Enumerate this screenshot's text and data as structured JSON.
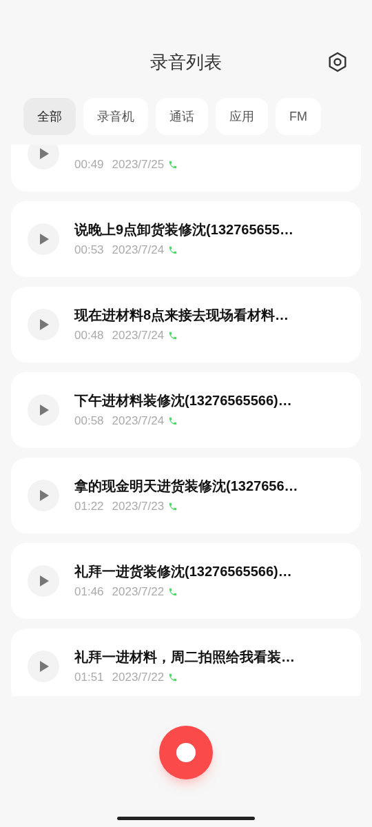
{
  "header": {
    "title": "录音列表"
  },
  "tabs": [
    {
      "label": "全部",
      "selected": true
    },
    {
      "label": "录音机",
      "selected": false
    },
    {
      "label": "通话",
      "selected": false
    },
    {
      "label": "应用",
      "selected": false
    },
    {
      "label": "FM",
      "selected": false
    }
  ],
  "recordings": [
    {
      "duration": "00:49",
      "date": "2023/7/25"
    },
    {
      "title": "说晚上9点卸货装修沈(132765655…",
      "duration": "00:53",
      "date": "2023/7/24"
    },
    {
      "title": "现在进材料8点来接去现场看材料…",
      "duration": "00:48",
      "date": "2023/7/24"
    },
    {
      "title": "下午进材料装修沈(13276565566)…",
      "duration": "00:58",
      "date": "2023/7/24"
    },
    {
      "title": "拿的现金明天进货装修沈(1327656…",
      "duration": "01:22",
      "date": "2023/7/23"
    },
    {
      "title": "礼拜一进货装修沈(13276565566)…",
      "duration": "01:46",
      "date": "2023/7/22"
    },
    {
      "title": "礼拜一进材料，周二拍照给我看装…",
      "duration": "01:51",
      "date": "2023/7/22"
    }
  ]
}
